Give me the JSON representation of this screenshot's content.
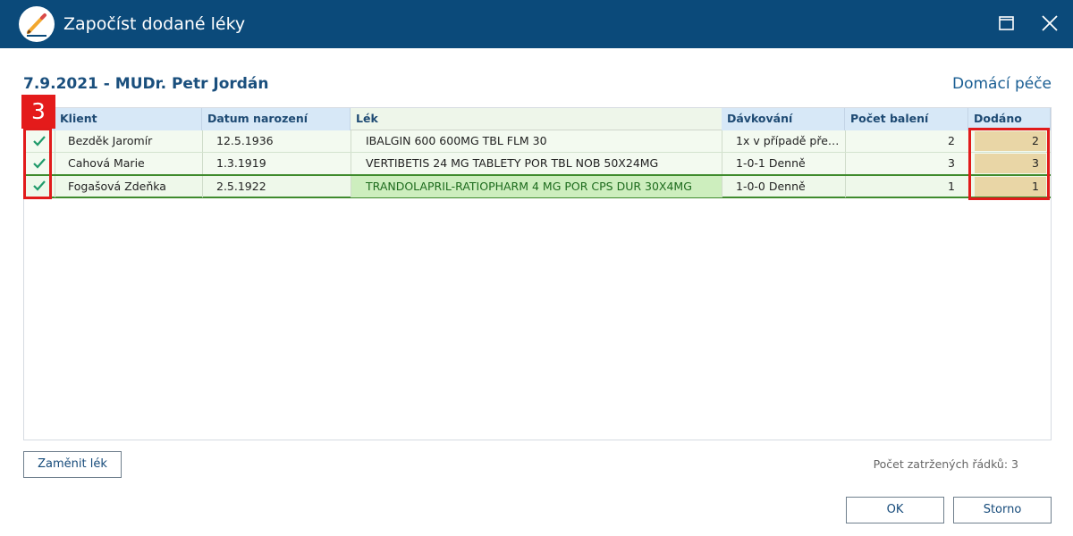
{
  "window": {
    "title": "Započíst dodané léky",
    "icon": "pencil-icon",
    "controls": [
      "maximize-icon",
      "close-icon"
    ]
  },
  "context": {
    "title": "7.9.2021 - MUDr. Petr Jordán",
    "care_type": "Domácí péče"
  },
  "table": {
    "columns": [
      "Klient",
      "Datum narození",
      "Lék",
      "Dávkování",
      "Počet balení",
      "Dodáno"
    ],
    "rows": [
      {
        "checked": true,
        "client": "Bezděk Jaromír",
        "birth": "12.5.1936",
        "drug": "IBALGIN 600 600MG TBL FLM 30",
        "dosage": "1x v případě pře…",
        "packages": "2",
        "delivered": "2"
      },
      {
        "checked": true,
        "client": "Cahová Marie",
        "birth": "1.3.1919",
        "drug": "VERTIBETIS 24 MG TABLETY POR TBL NOB 50X24MG",
        "dosage": "1-0-1 Denně",
        "packages": "3",
        "delivered": "3"
      },
      {
        "checked": true,
        "client": "Fogašová Zdeňka",
        "birth": "2.5.1922",
        "drug": "TRANDOLAPRIL-RATIOPHARM 4 MG POR CPS DUR 30X4MG",
        "dosage": "1-0-0 Denně",
        "packages": "1",
        "delivered": "1"
      }
    ]
  },
  "annotation": {
    "badge": "3"
  },
  "footer": {
    "replace_button": "Zaměnit lék",
    "checked_count": "Počet zatržených řádků: 3",
    "ok_button": "OK",
    "cancel_button": "Storno"
  },
  "colors": {
    "titlebar": "#0b4a7a",
    "header_blue": "#d7e8f7",
    "row_green": "#f3faf0",
    "delivered_fill": "#e9d6a6",
    "highlight_red": "#e11b1b",
    "selection_green": "#3f8b2d"
  }
}
